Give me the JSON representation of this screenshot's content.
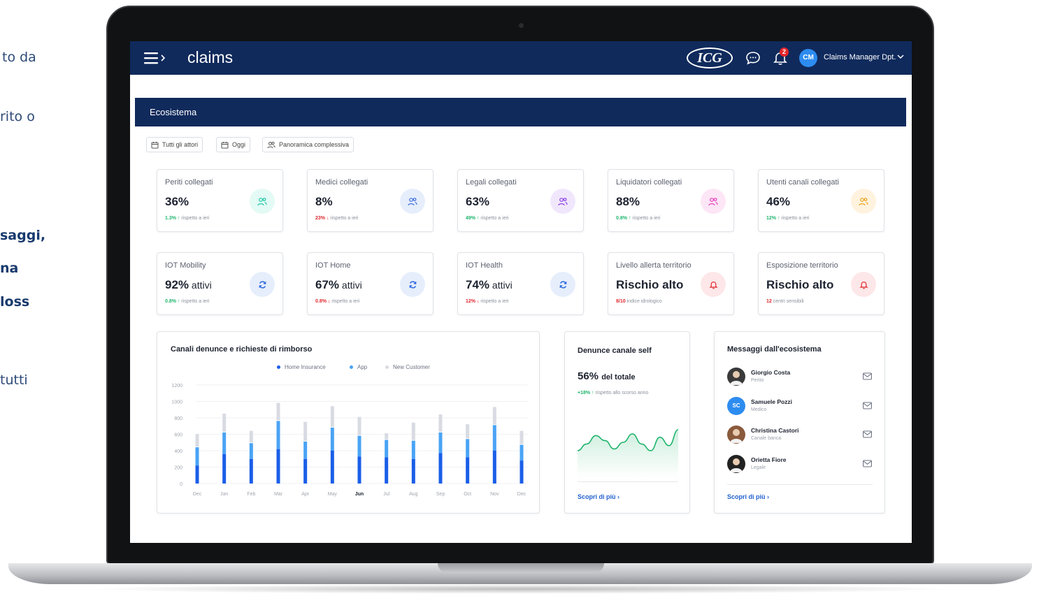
{
  "side_text": [
    {
      "text": "to da",
      "bold": false
    },
    {
      "text": "rito o",
      "bold": false
    },
    {
      "text": "saggi,",
      "bold": true
    },
    {
      "text": "na",
      "bold": true
    },
    {
      "text": "loss",
      "bold": true
    },
    {
      "text": "tutti",
      "bold": false
    }
  ],
  "header": {
    "app_title": "claims",
    "logo_text": "ICG",
    "notifications_count": "2",
    "avatar_initials": "CM",
    "user_name": "Claims Manager Dpt."
  },
  "section": {
    "title": "Ecosistema"
  },
  "filters": [
    {
      "label": "Tutti gli attori",
      "icon": "calendar-icon"
    },
    {
      "label": "Oggi",
      "icon": "calendar-icon"
    },
    {
      "label": "Panoramica complessiva",
      "icon": "people-icon"
    }
  ],
  "kpi_cards": [
    {
      "label": "Periti collegati",
      "value": "36%",
      "unit": "",
      "delta": "1.3%",
      "direction": "up",
      "note": "rispetto a ieri",
      "icon": "people-icon",
      "icon_color": "#1ec8a5",
      "icon_bg": "#e3faf5"
    },
    {
      "label": "Medici collegati",
      "value": "8%",
      "unit": "",
      "delta": "23%",
      "direction": "down",
      "note": "rispetto a ieri",
      "icon": "people-icon",
      "icon_color": "#3f6fd8",
      "icon_bg": "#e6eefc"
    },
    {
      "label": "Legali collegati",
      "value": "63%",
      "unit": "",
      "delta": "49%",
      "direction": "up",
      "note": "rispetto a ieri",
      "icon": "people-icon",
      "icon_color": "#8a3fe0",
      "icon_bg": "#f1e7fd"
    },
    {
      "label": "Liquidatori collegati",
      "value": "88%",
      "unit": "",
      "delta": "0.8%",
      "direction": "up",
      "note": "rispetto a ieri",
      "icon": "people-icon",
      "icon_color": "#e53fbf",
      "icon_bg": "#fde6f6"
    },
    {
      "label": "Utenti canali collegati",
      "value": "46%",
      "unit": "",
      "delta": "12%",
      "direction": "up",
      "note": "rispetto a ieri",
      "icon": "people-icon",
      "icon_color": "#f0a21d",
      "icon_bg": "#fff3df"
    },
    {
      "label": "IOT Mobility",
      "value": "92%",
      "unit": "attivi",
      "delta": "0.8%",
      "direction": "up",
      "note": "rispetto a ieri",
      "icon": "refresh-icon",
      "icon_color": "#2b67e0",
      "icon_bg": "#e6eefc"
    },
    {
      "label": "IOT Home",
      "value": "67%",
      "unit": "attivi",
      "delta": "0.8%",
      "direction": "down",
      "note": "rispetto a ieri",
      "icon": "refresh-icon",
      "icon_color": "#2b67e0",
      "icon_bg": "#e6eefc"
    },
    {
      "label": "IOT Health",
      "value": "74%",
      "unit": "attivi",
      "delta": "12%",
      "direction": "down",
      "note": "rispetto a ieri",
      "icon": "refresh-icon",
      "icon_color": "#2b67e0",
      "icon_bg": "#e6eefc"
    },
    {
      "label": "Livello allerta territorio",
      "value": "Rischio alto",
      "unit": "",
      "delta": "8/10",
      "direction": "none",
      "note": "indice idrologico",
      "icon": "bell-icon",
      "icon_color": "#e0282e",
      "icon_bg": "#fde7e8"
    },
    {
      "label": "Esposizione territorio",
      "value": "Rischio alto",
      "unit": "",
      "delta": "12",
      "direction": "none",
      "note": "centri sensibili",
      "icon": "bell-icon",
      "icon_color": "#e0282e",
      "icon_bg": "#fde7e8"
    }
  ],
  "colors": {
    "navy": "#102a5c",
    "up": "#1fb46c",
    "down": "#e0282e",
    "link": "#1f5fcf"
  },
  "chart_data": {
    "type": "bar",
    "title": "Canali denunce e richieste di rimborso",
    "categories": [
      "Dec",
      "Jan",
      "Feb",
      "Mar",
      "Apr",
      "May",
      "Jun",
      "Jul",
      "Aug",
      "Sep",
      "Oct",
      "Nov",
      "Dec"
    ],
    "highlight_category_index": 6,
    "series": [
      {
        "name": "Home Insurance",
        "color": "#1a5ee8",
        "values": [
          220,
          360,
          300,
          420,
          300,
          400,
          330,
          320,
          300,
          370,
          320,
          400,
          280
        ]
      },
      {
        "name": "App",
        "color": "#4aa3f5",
        "values": [
          230,
          270,
          200,
          350,
          220,
          290,
          260,
          220,
          230,
          260,
          230,
          320,
          200
        ]
      },
      {
        "name": "New Customer",
        "color": "#d8dbe2",
        "values": [
          160,
          230,
          150,
          220,
          240,
          260,
          230,
          80,
          220,
          220,
          180,
          220,
          170
        ]
      }
    ],
    "stacked": true,
    "ylim": [
      0,
      1200
    ],
    "yticks": [
      0,
      200,
      400,
      600,
      800,
      1000,
      1200
    ],
    "legend_position": "top-center",
    "grid": true
  },
  "self_channel": {
    "title": "Denunce canale self",
    "value": "56%",
    "value_suffix": "del totale",
    "delta": "+18%",
    "note": "rispetto allo scorso anno",
    "link": "Scopri di più",
    "trend": [
      30,
      22,
      12,
      18,
      28,
      20,
      10,
      22,
      30,
      14,
      24,
      5
    ]
  },
  "messages": {
    "title": "Messaggi dall'ecosistema",
    "items": [
      {
        "name": "Giorgio Costa",
        "role": "Perito",
        "avatar": "photo",
        "avatar_color": "#3a3a3a"
      },
      {
        "name": "Samuele Pozzi",
        "role": "Medico",
        "avatar": "SC",
        "avatar_color": "#2d8cf0"
      },
      {
        "name": "Christina Castori",
        "role": "Canale banca",
        "avatar": "photo",
        "avatar_color": "#8a5a3c"
      },
      {
        "name": "Orietta Fiore",
        "role": "Legale",
        "avatar": "photo",
        "avatar_color": "#222222"
      }
    ],
    "link": "Scopri di più"
  }
}
